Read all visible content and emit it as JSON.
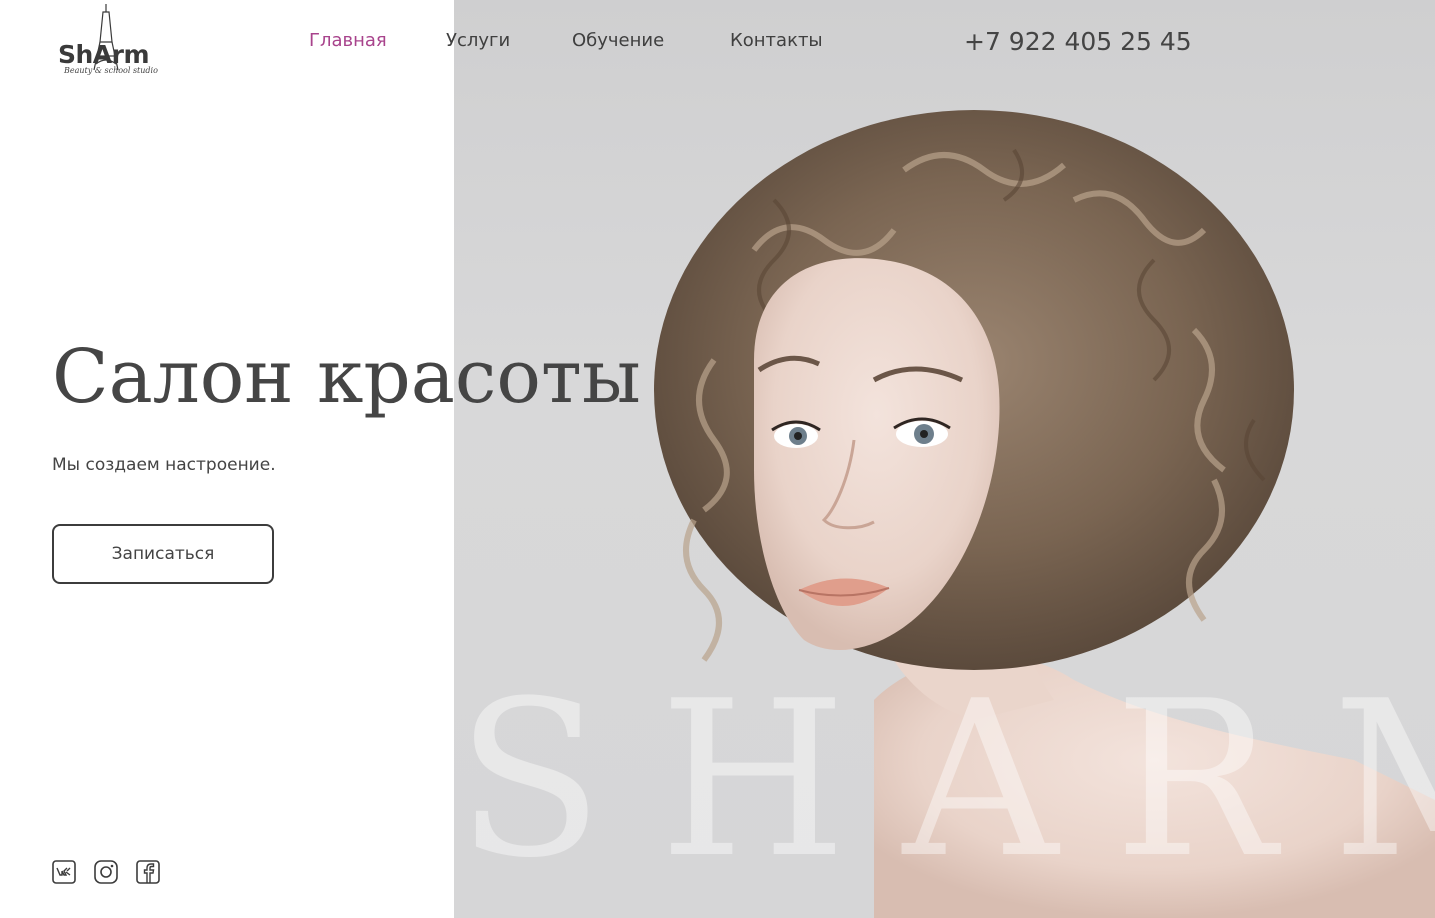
{
  "brand": {
    "logo_text": "ShArm",
    "logo_tagline": "Beauty & school studio"
  },
  "nav": {
    "items": [
      {
        "label": "Главная",
        "active": true
      },
      {
        "label": "Услуги",
        "active": false
      },
      {
        "label": "Обучение",
        "active": false
      },
      {
        "label": "Контакты",
        "active": false
      }
    ],
    "active_color": "#a8438c"
  },
  "contact": {
    "phone": "+7 922 405 25 45"
  },
  "hero": {
    "title": "Салон красоты",
    "subtitle": "Мы создаем настроение.",
    "cta_label": "Записаться",
    "watermark": "SHARM"
  },
  "social": [
    {
      "icon": "vk-icon"
    },
    {
      "icon": "instagram-icon"
    },
    {
      "icon": "facebook-icon"
    }
  ],
  "colors": {
    "text": "#3c3c3c",
    "photo_background": "#d6d6d7"
  }
}
